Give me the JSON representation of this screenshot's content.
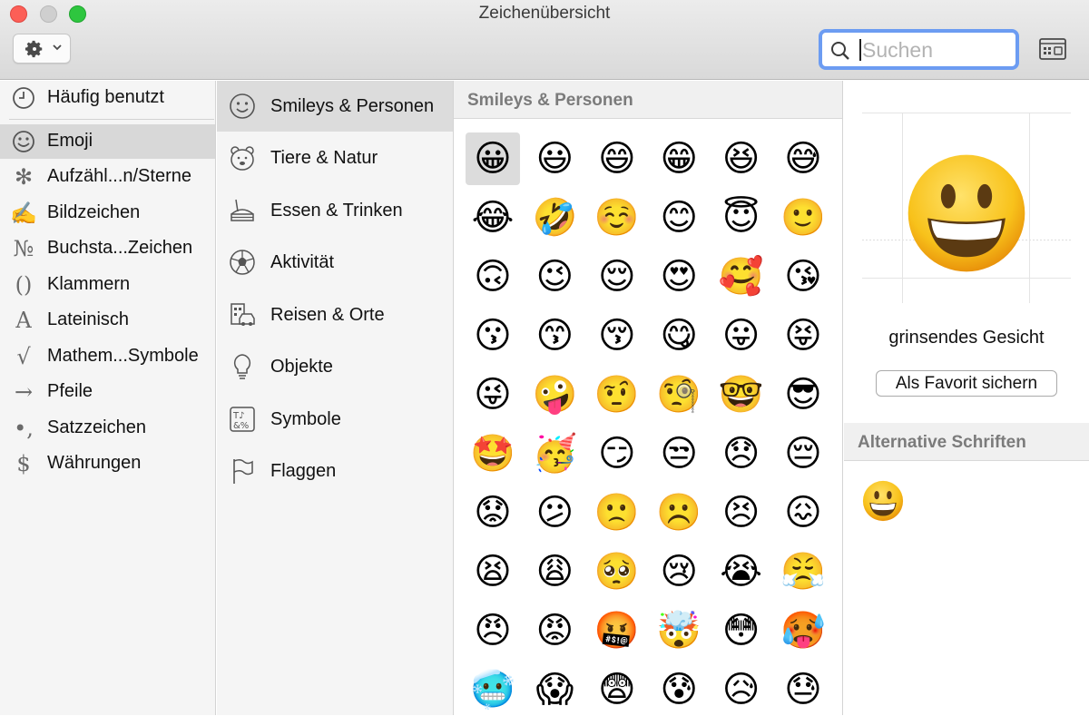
{
  "window": {
    "title": "Zeichenübersicht"
  },
  "toolbar": {
    "search_placeholder": "Suchen",
    "gear_icon": "gear-icon",
    "keyboard_icon": "keyboard-viewer-icon"
  },
  "sidebar": {
    "items": [
      {
        "label": "Häufig benutzt",
        "icon": "clock-icon"
      },
      {
        "label": "Emoji",
        "icon": "smiley-icon",
        "selected": true
      },
      {
        "label": "Aufzähl...n/Sterne",
        "icon": "asterisk-icon"
      },
      {
        "label": "Bildzeichen",
        "icon": "writing-hand-icon"
      },
      {
        "label": "Buchsta...Zeichen",
        "icon": "numero-icon"
      },
      {
        "label": "Klammern",
        "icon": "parentheses-icon"
      },
      {
        "label": "Lateinisch",
        "icon": "latin-a-icon"
      },
      {
        "label": "Mathem...Symbole",
        "icon": "square-root-icon"
      },
      {
        "label": "Pfeile",
        "icon": "arrow-icon"
      },
      {
        "label": "Satzzeichen",
        "icon": "punctuation-icon"
      },
      {
        "label": "Währungen",
        "icon": "dollar-icon"
      }
    ]
  },
  "categories": {
    "items": [
      {
        "label": "Smileys & Personen",
        "icon": "smiley-outline-icon",
        "selected": true
      },
      {
        "label": "Tiere & Natur",
        "icon": "bear-icon"
      },
      {
        "label": "Essen & Trinken",
        "icon": "food-icon"
      },
      {
        "label": "Aktivität",
        "icon": "soccer-ball-icon"
      },
      {
        "label": "Reisen & Orte",
        "icon": "building-car-icon"
      },
      {
        "label": "Objekte",
        "icon": "lightbulb-icon"
      },
      {
        "label": "Symbole",
        "icon": "symbols-icon"
      },
      {
        "label": "Flaggen",
        "icon": "flag-icon"
      }
    ]
  },
  "grid": {
    "header": "Smileys & Personen",
    "selected_index": 0,
    "emojis": [
      "😀",
      "😃",
      "😄",
      "😁",
      "😆",
      "😅",
      "😂",
      "🤣",
      "☺️",
      "😊",
      "😇",
      "🙂",
      "🙃",
      "😉",
      "😌",
      "😍",
      "🥰",
      "😘",
      "😗",
      "😙",
      "😚",
      "😋",
      "😛",
      "😝",
      "😜",
      "🤪",
      "🤨",
      "🧐",
      "🤓",
      "😎",
      "🤩",
      "🥳",
      "😏",
      "😒",
      "😞",
      "😔",
      "😟",
      "😕",
      "🙁",
      "☹️",
      "😣",
      "😖",
      "😫",
      "😩",
      "🥺",
      "😢",
      "😭",
      "😤",
      "😠",
      "😡",
      "🤬",
      "🤯",
      "😳",
      "🥵",
      "🥶",
      "😱",
      "😨",
      "😰",
      "😥",
      "😓"
    ]
  },
  "detail": {
    "char_name": "grinsendes Gesicht",
    "favorite_button": "Als Favorit sichern",
    "alt_header": "Alternative Schriften"
  }
}
